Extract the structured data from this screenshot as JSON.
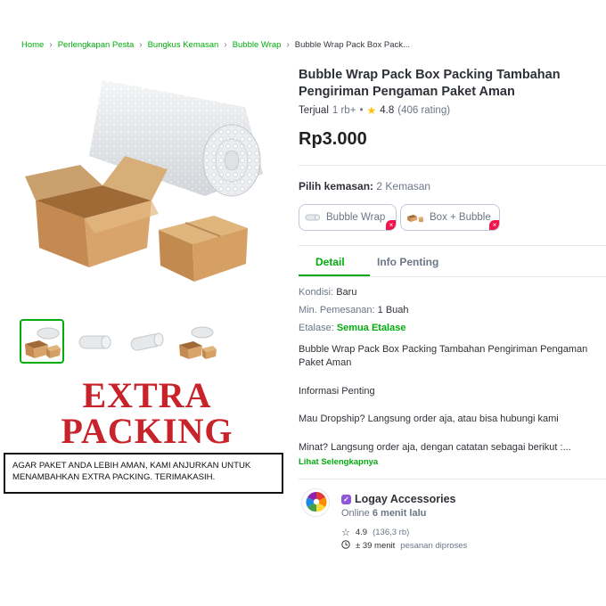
{
  "breadcrumb": {
    "items": [
      "Home",
      "Perlengkapan Pesta",
      "Bungkus Kemasan",
      "Bubble Wrap"
    ],
    "current": "Bubble Wrap Pack Box Pack..."
  },
  "product": {
    "title": "Bubble Wrap Pack Box Packing Tambahan Pengiriman Pengaman Paket Aman",
    "sold_label": "Terjual",
    "sold_count": "1 rb+",
    "rating": "4.8",
    "rating_count": "(406 rating)",
    "price": "Rp3.000"
  },
  "variants": {
    "label": "Pilih kemasan:",
    "count": "2 Kemasan",
    "options": [
      "Bubble Wrap",
      "Box + Bubble"
    ]
  },
  "tabs": [
    "Detail",
    "Info Penting"
  ],
  "details": {
    "condition_key": "Kondisi:",
    "condition_value": "Baru",
    "min_order_key": "Min. Pemesanan:",
    "min_order_value": "1 Buah",
    "showcase_key": "Etalase:",
    "showcase_value": "Semua Etalase"
  },
  "description": {
    "p1": "Bubble Wrap Pack Box Packing Tambahan Pengiriman Pengaman Paket Aman",
    "p2": "Informasi Penting",
    "p3": "Mau Dropship? Langsung order aja, atau bisa hubungi kami",
    "p4": "Minat? Langsung order aja, dengan catatan sebagai berikut :...",
    "see_more": "Lihat Selengkapnya"
  },
  "image_text": {
    "line1": "EXTRA",
    "line2": "PACKING",
    "notice": "AGAR PAKET ANDA LEBIH AMAN, KAMI ANJURKAN UNTUK MENAMBAHKAN EXTRA PACKING. TERIMAKASIH."
  },
  "shop": {
    "name": "Logay Accessories",
    "online_label": "Online",
    "online_time": "6 menit lalu",
    "rating": "4.9",
    "rating_count": "(136,3 rb)",
    "process_time": "± 39 menit",
    "process_label": "pesanan diproses"
  },
  "colors": {
    "accent": "#03ac0e",
    "star": "#ffc400",
    "extra_text": "#c8222a",
    "badge": "#8e56d8"
  }
}
